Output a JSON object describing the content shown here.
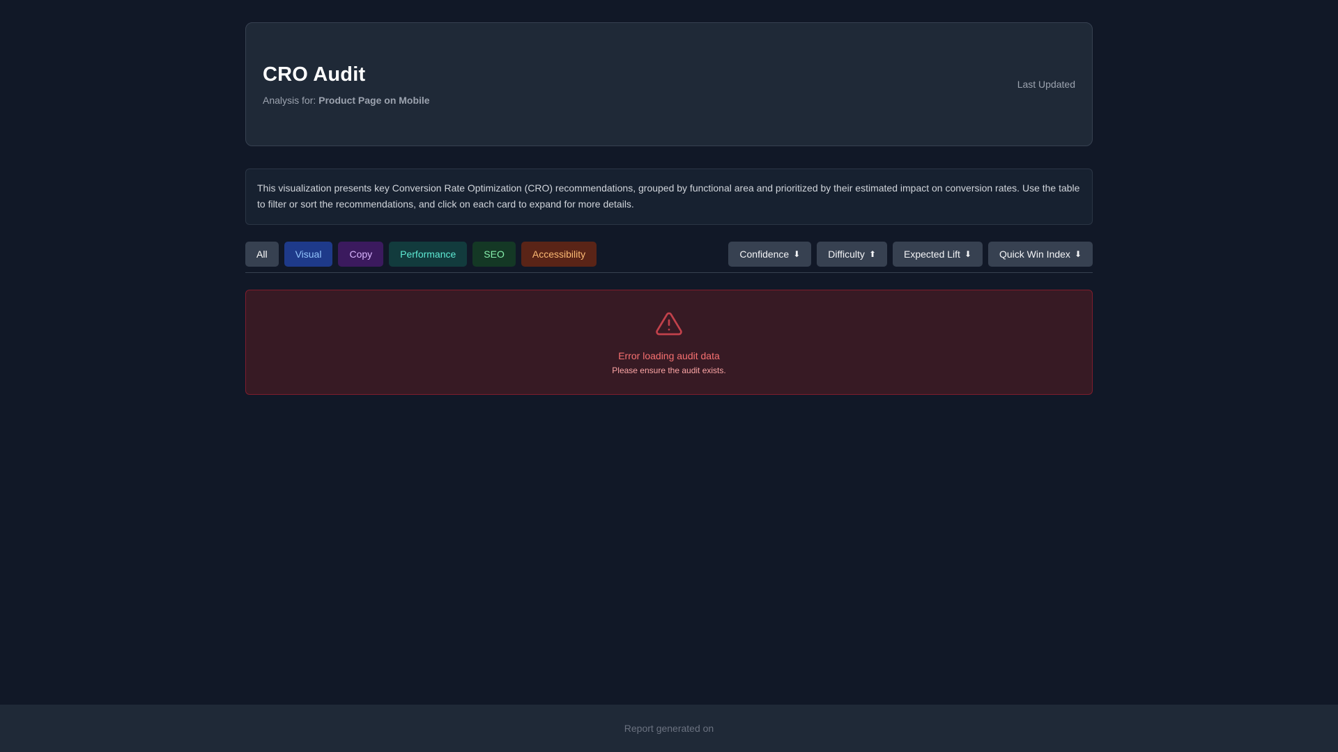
{
  "header": {
    "title": "CRO Audit",
    "analysis_prefix": "Analysis for:",
    "analysis_target": "Product Page on Mobile",
    "last_updated_label": "Last Updated"
  },
  "description": "This visualization presents key Conversion Rate Optimization (CRO) recommendations, grouped by functional area and prioritized by their estimated impact on conversion rates. Use the table to filter or sort the recommendations, and click on each card to expand for more details.",
  "filters": [
    {
      "label": "All"
    },
    {
      "label": "Visual"
    },
    {
      "label": "Copy"
    },
    {
      "label": "Performance"
    },
    {
      "label": "SEO"
    },
    {
      "label": "Accessibility"
    }
  ],
  "sorts": [
    {
      "label": "Confidence",
      "arrow": "⬇"
    },
    {
      "label": "Difficulty",
      "arrow": "⬆"
    },
    {
      "label": "Expected Lift",
      "arrow": "⬇"
    },
    {
      "label": "Quick Win Index",
      "arrow": "⬇"
    }
  ],
  "error": {
    "icon": "warning-triangle-icon",
    "title": "Error loading audit data",
    "message": "Please ensure the audit exists."
  },
  "footer": {
    "text": "Report generated on"
  },
  "colors": {
    "background": "#111827",
    "card": "#1f2937",
    "error_accent": "#f87171"
  }
}
